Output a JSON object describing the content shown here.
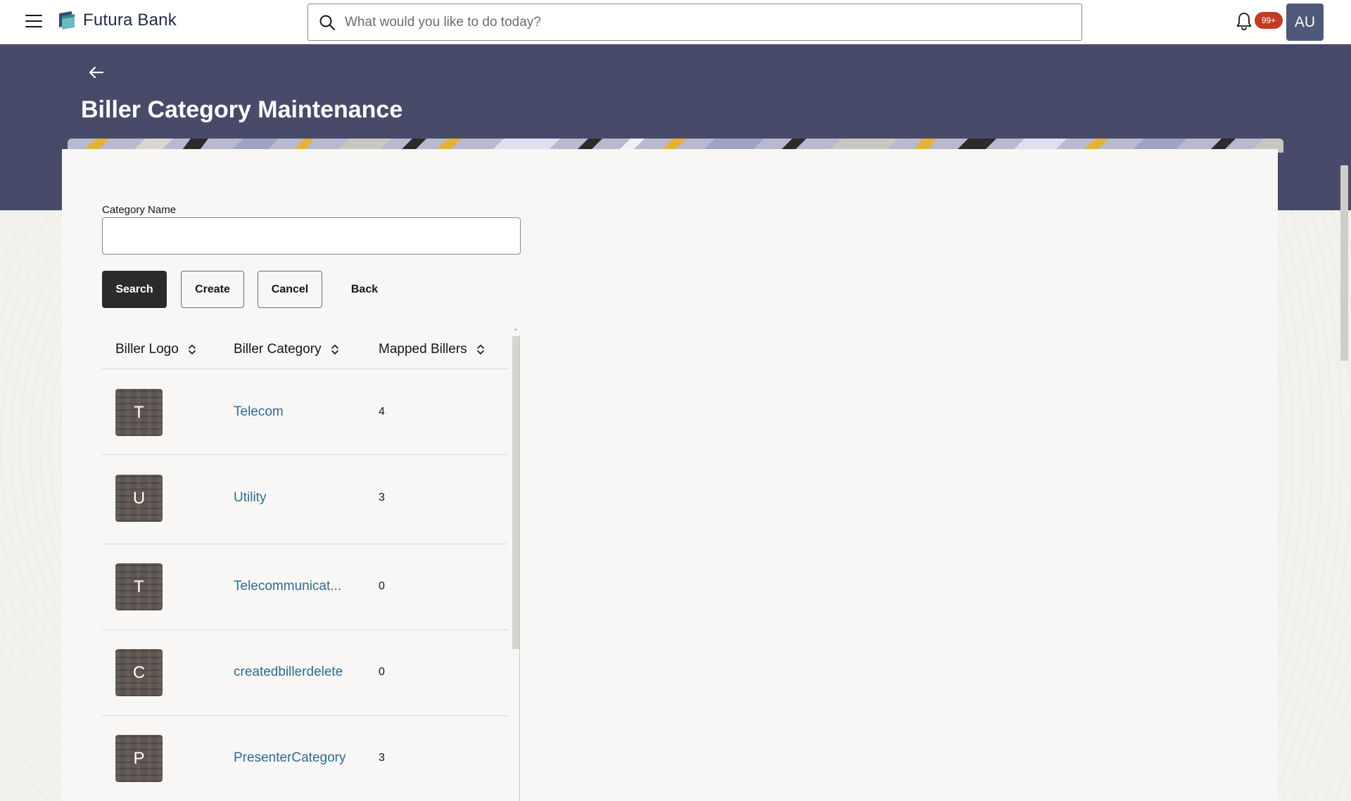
{
  "header": {
    "brand_name": "Futura Bank",
    "search_placeholder": "What would you like to do today?",
    "notification_count": "99+",
    "avatar_initials": "AU"
  },
  "page": {
    "title": "Biller Category Maintenance"
  },
  "form": {
    "category_name_label": "Category Name",
    "category_name_value": ""
  },
  "buttons": {
    "search": "Search",
    "create": "Create",
    "cancel": "Cancel",
    "back": "Back"
  },
  "table": {
    "columns": [
      "Biller Logo",
      "Biller Category",
      "Mapped Billers"
    ],
    "rows": [
      {
        "initial": "T",
        "category": "Telecom",
        "mapped": "4"
      },
      {
        "initial": "U",
        "category": "Utility",
        "mapped": "3"
      },
      {
        "initial": "T",
        "category": "Telecommunicat...",
        "mapped": "0"
      },
      {
        "initial": "C",
        "category": "createdbillerdelete",
        "mapped": "0"
      },
      {
        "initial": "P",
        "category": "PresenterCategory",
        "mapped": "3"
      }
    ]
  },
  "colors": {
    "banner": "#474b69",
    "link": "#2f6b8f",
    "primary_button": "#2b2b2b",
    "badge": "#c23b22",
    "avatar": "#4f5879"
  }
}
